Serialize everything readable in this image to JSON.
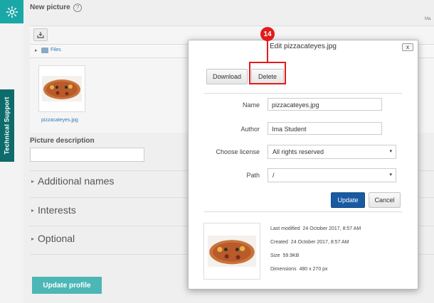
{
  "sidebar": {
    "support_label": "Technical Support",
    "accent_color": "#1aa7a7"
  },
  "form": {
    "new_picture_label": "New picture",
    "help_icon": "?",
    "top_right_hint": "Ma",
    "files_label": "Files",
    "thumbnail_caption": "pizzacateyes.jpg",
    "picture_description_label": "Picture description",
    "picture_description_value": "",
    "sections": [
      "Additional names",
      "Interests",
      "Optional"
    ],
    "update_profile_label": "Update profile"
  },
  "dialog": {
    "title": "Edit pizzacateyes.jpg",
    "close_label": "x",
    "download_label": "Download",
    "delete_label": "Delete",
    "name_label": "Name",
    "name_value": "pizzacateyes.jpg",
    "author_label": "Author",
    "author_value": "Ima Student",
    "license_label": "Choose license",
    "license_value": "All rights reserved",
    "path_label": "Path",
    "path_value": "/",
    "update_label": "Update",
    "cancel_label": "Cancel",
    "meta": {
      "last_modified_label": "Last modified",
      "last_modified_value": "24 October 2017, 8:57 AM",
      "created_label": "Created",
      "created_value": "24 October 2017, 8:57 AM",
      "size_label": "Size",
      "size_value": "59.9KB",
      "dimensions_label": "Dimensions",
      "dimensions_value": "480 x 270 px"
    }
  },
  "annotation": {
    "step_number": "14",
    "color": "#e21b1b"
  }
}
